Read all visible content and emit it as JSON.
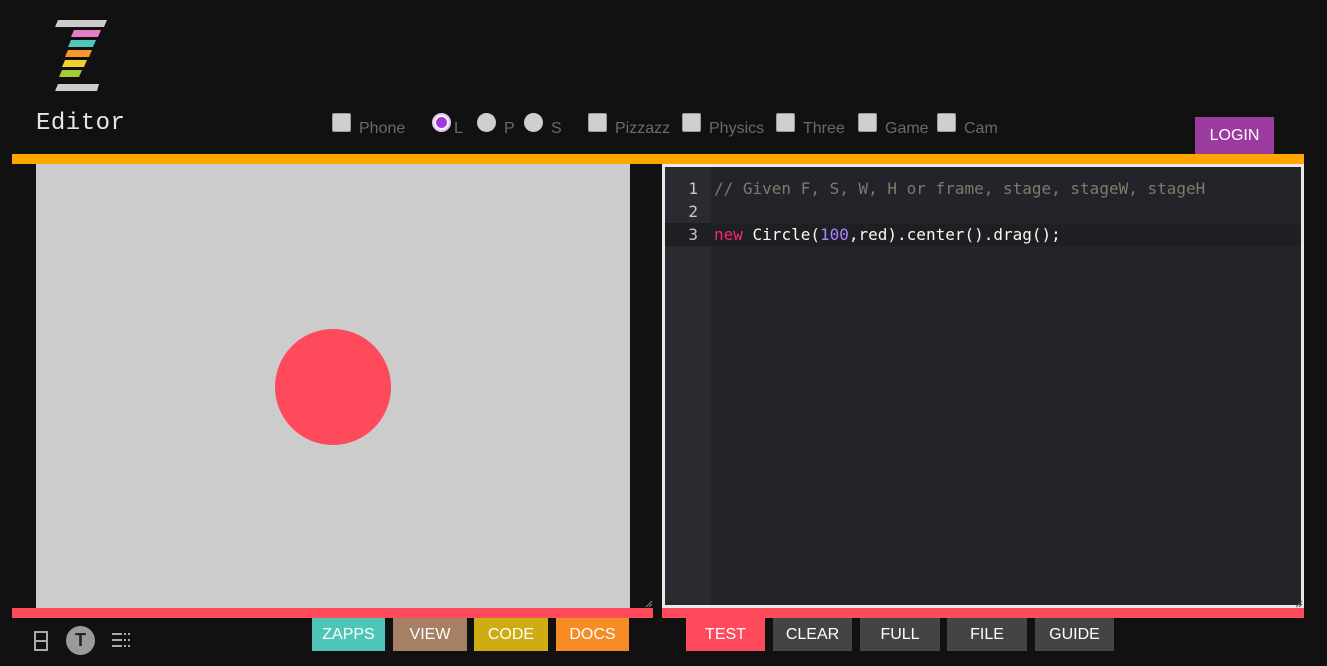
{
  "header": {
    "logo_alt": "Z",
    "title": "Editor",
    "logo_colors": [
      "#cccccc",
      "#e87ccb",
      "#4fc8bb",
      "#f7962a",
      "#f0cf30",
      "#a3cc3a",
      "#cccccc"
    ]
  },
  "options": {
    "phone": {
      "label": "Phone",
      "checked": false
    },
    "orientation": [
      {
        "label": "L",
        "checked": true
      },
      {
        "label": "P",
        "checked": false
      },
      {
        "label": "S",
        "checked": false
      }
    ],
    "modules": [
      {
        "label": "Pizzazz",
        "checked": false
      },
      {
        "label": "Physics",
        "checked": false
      },
      {
        "label": "Three",
        "checked": false
      },
      {
        "label": "Game",
        "checked": false
      },
      {
        "label": "Cam",
        "checked": false
      }
    ]
  },
  "login_label": "LOGIN",
  "stage": {
    "background": "#cccccc",
    "circle": {
      "radius": 100,
      "color": "#fe4a5a"
    }
  },
  "editor": {
    "lines": [
      {
        "number": "1",
        "tokens": [
          {
            "type": "comment",
            "text": "// Given F, S, W, H or frame, stage, stageW, stageH"
          }
        ]
      },
      {
        "number": "2",
        "tokens": []
      },
      {
        "number": "3",
        "tokens": [
          {
            "type": "kw",
            "text": "new"
          },
          {
            "type": "plain",
            "text": " Circle("
          },
          {
            "type": "num",
            "text": "100"
          },
          {
            "type": "plain",
            "text": ",red).center().drag();"
          }
        ]
      }
    ],
    "active_line": 3
  },
  "bottom_icons": [
    {
      "name": "split-layout-icon"
    },
    {
      "name": "text-toggle-icon",
      "glyph": "T"
    },
    {
      "name": "list-view-icon"
    }
  ],
  "left_buttons": [
    {
      "label": "ZAPPS",
      "color": "#4fc5b8"
    },
    {
      "label": "VIEW",
      "color": "#a68064"
    },
    {
      "label": "CODE",
      "color": "#ceac12"
    },
    {
      "label": "DOCS",
      "color": "#f78b24"
    }
  ],
  "right_buttons": [
    {
      "label": "TEST",
      "color": "#fe4a5a"
    },
    {
      "label": "CLEAR",
      "color": "#444444"
    },
    {
      "label": "FULL",
      "color": "#444444"
    },
    {
      "label": "FILE",
      "color": "#444444"
    },
    {
      "label": "GUIDE",
      "color": "#444444"
    }
  ]
}
